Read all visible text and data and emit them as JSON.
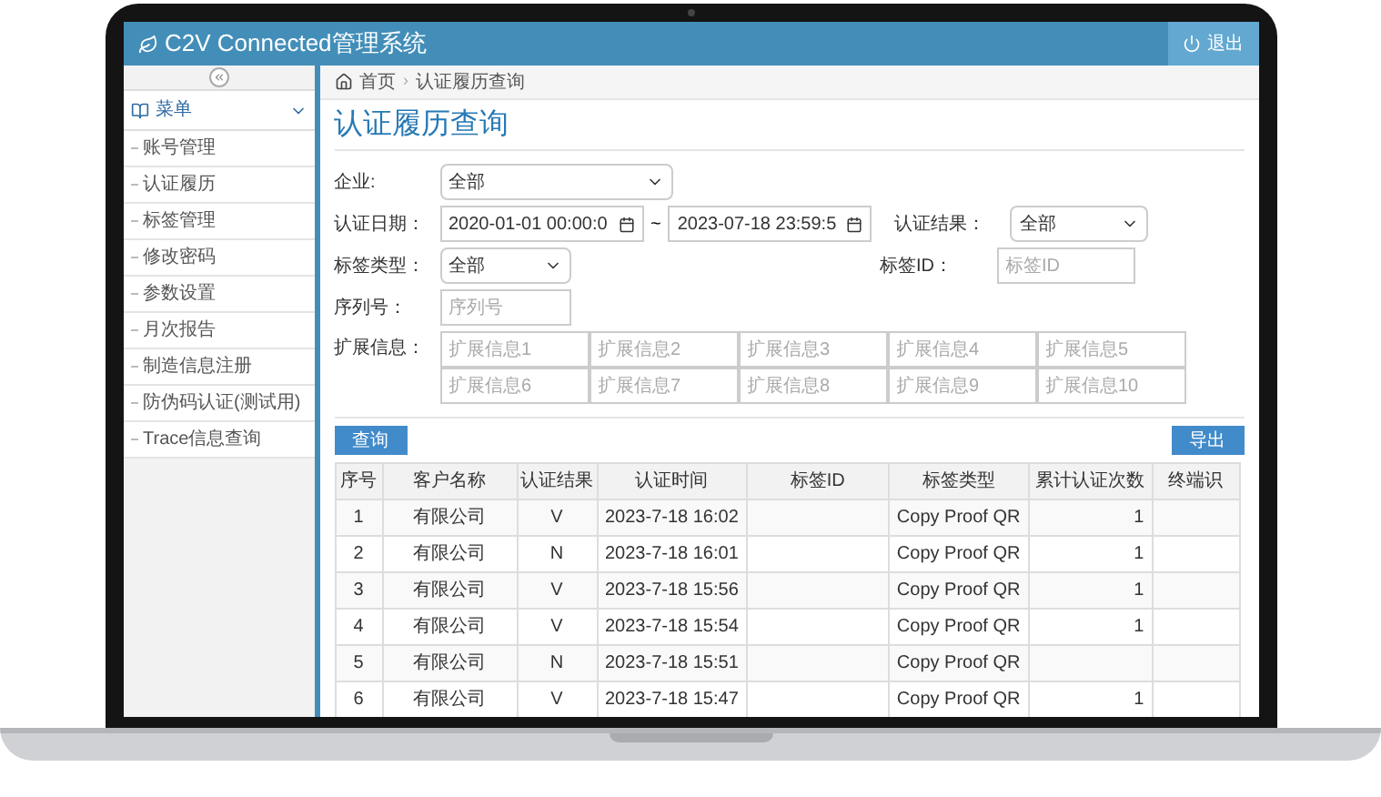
{
  "app": {
    "title": "C2V Connected管理系统",
    "logout": "退出"
  },
  "sidebar": {
    "menu_label": "菜单",
    "expanded": true,
    "items": [
      {
        "label": "账号管理"
      },
      {
        "label": "认证履历"
      },
      {
        "label": "标签管理"
      },
      {
        "label": "修改密码"
      },
      {
        "label": "参数设置"
      },
      {
        "label": "月次报告"
      },
      {
        "label": "制造信息注册"
      },
      {
        "label": "防伪码认证(测试用)"
      },
      {
        "label": "Trace信息查询"
      }
    ]
  },
  "breadcrumb": [
    "首页",
    "认证履历查询"
  ],
  "breadcrumb_separator": "›",
  "page_title": "认证履历查询",
  "filters": {
    "company": {
      "label": "企业:",
      "value": "全部"
    },
    "date": {
      "label": "认证日期：",
      "from": "2020-01-01 00:00:0",
      "separator": "~",
      "to": "2023-07-18 23:59:5"
    },
    "result": {
      "label": "认证结果：",
      "value": "全部"
    },
    "tag_type": {
      "label": "标签类型：",
      "value": "全部"
    },
    "tag_id": {
      "label": "标签ID：",
      "placeholder": "标签ID"
    },
    "serial": {
      "label": "序列号：",
      "placeholder": "序列号"
    },
    "extended": {
      "label": "扩展信息：",
      "placeholders": [
        "扩展信息1",
        "扩展信息2",
        "扩展信息3",
        "扩展信息4",
        "扩展信息5",
        "扩展信息6",
        "扩展信息7",
        "扩展信息8",
        "扩展信息9",
        "扩展信息10"
      ]
    }
  },
  "buttons": {
    "search": "查询",
    "export": "导出"
  },
  "table": {
    "columns": [
      "序号",
      "客户名称",
      "认证结果",
      "认证时间",
      "标签ID",
      "标签类型",
      "累计认证次数",
      "终端识"
    ],
    "rows": [
      {
        "no": "1",
        "customer": "有限公司",
        "result": "V",
        "time": "2023-7-18 16:02",
        "tag_type": "Copy Proof QR",
        "count": "1"
      },
      {
        "no": "2",
        "customer": "有限公司",
        "result": "N",
        "time": "2023-7-18 16:01",
        "tag_type": "Copy Proof QR",
        "count": "1"
      },
      {
        "no": "3",
        "customer": "有限公司",
        "result": "V",
        "time": "2023-7-18 15:56",
        "tag_type": "Copy Proof QR",
        "count": "1"
      },
      {
        "no": "4",
        "customer": "有限公司",
        "result": "V",
        "time": "2023-7-18 15:54",
        "tag_type": "Copy Proof QR",
        "count": "1"
      },
      {
        "no": "5",
        "customer": "有限公司",
        "result": "N",
        "time": "2023-7-18 15:51",
        "tag_type": "Copy Proof QR"
      },
      {
        "no": "6",
        "customer": "有限公司",
        "result": "V",
        "time": "2023-7-18 15:47",
        "tag_type": "Copy Proof QR",
        "count": "1"
      }
    ]
  }
}
